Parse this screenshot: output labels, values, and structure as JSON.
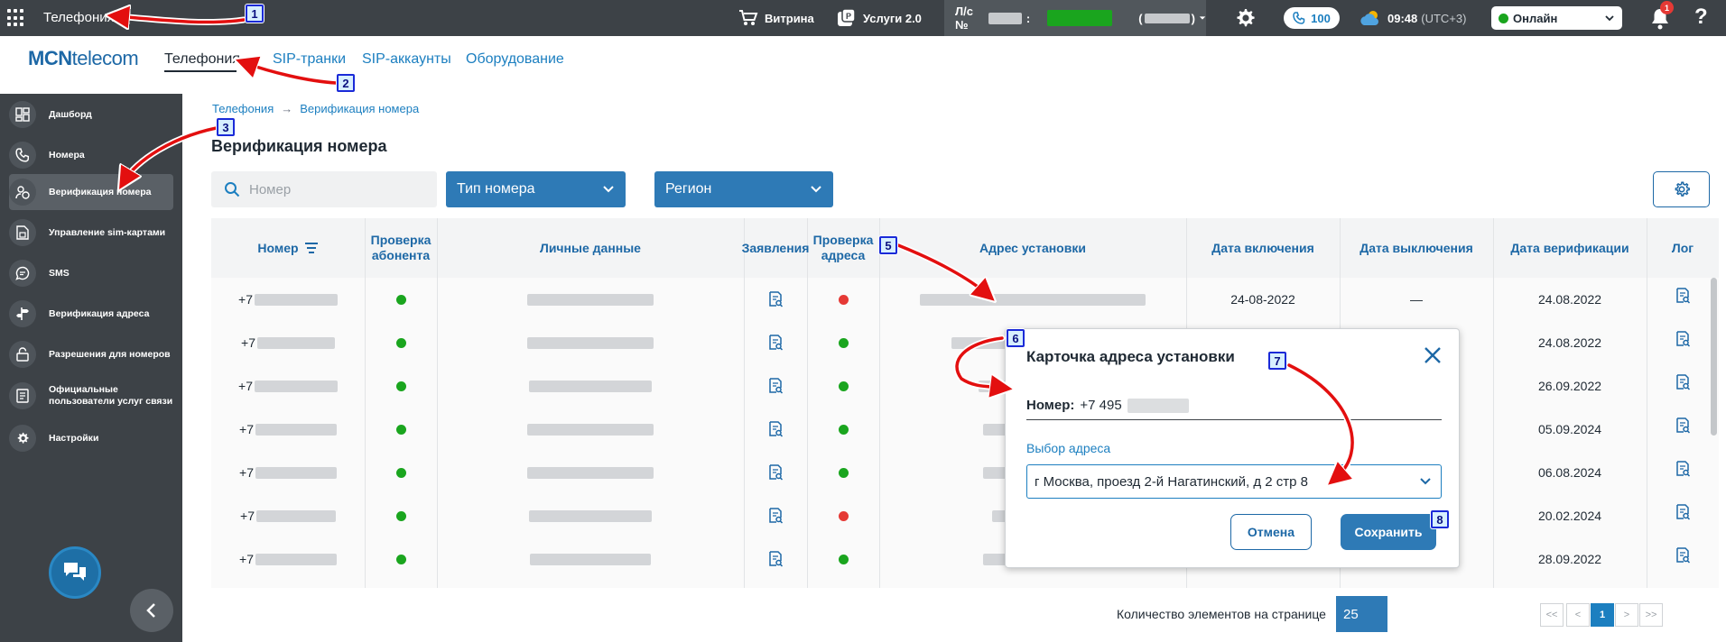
{
  "topbar": {
    "app_title": "Телефония",
    "showcase_label": "Витрина",
    "services_label": "Услуги 2.0",
    "account_prefix": "Л/с №",
    "account_sep": ":",
    "call_count": "100",
    "time": "09:48",
    "timezone": "(UTC+3)",
    "status_value": "Онлайн",
    "notification_count": "1",
    "help_label": "?"
  },
  "header": {
    "logo_bold": "MCN",
    "logo_rest": "telecom",
    "tabs": [
      {
        "label": "Телефония"
      },
      {
        "label": "SIP-транки"
      },
      {
        "label": "SIP-аккаунты"
      },
      {
        "label": "Оборудование"
      }
    ]
  },
  "sidebar": {
    "items": [
      {
        "label": "Дашборд"
      },
      {
        "label": "Номера"
      },
      {
        "label": "Верификация номера"
      },
      {
        "label": "Управление sim-картами"
      },
      {
        "label": "SMS"
      },
      {
        "label": "Верификация адреса"
      },
      {
        "label": "Разрешения для номеров"
      },
      {
        "label": "Официальные пользователи услуг связи"
      },
      {
        "label": "Настройки"
      }
    ]
  },
  "main": {
    "breadcrumb": [
      "Телефония",
      "Верификация номера"
    ],
    "title": "Верификация номера",
    "search_placeholder": "Номер",
    "filter_type": "Тип номера",
    "filter_region": "Регион"
  },
  "table": {
    "columns": [
      "Номер",
      "Проверка абонента",
      "Личные данные",
      "Заявления",
      "Проверка адреса",
      "Адрес установки",
      "Дата включения",
      "Дата выключения",
      "Дата верификации",
      "Лог"
    ],
    "rows": [
      {
        "number_prefix": "+7",
        "subscriber_check": "green",
        "address_check": "red",
        "date_on": "24-08-2022",
        "date_off": "—",
        "date_verified": "24.08.2022"
      },
      {
        "number_prefix": "+7",
        "subscriber_check": "green",
        "address_check": "green",
        "date_on": "",
        "date_off": "",
        "date_verified": "24.08.2022"
      },
      {
        "number_prefix": "+7",
        "subscriber_check": "green",
        "address_check": "green",
        "date_on": "",
        "date_off": "",
        "date_verified": "26.09.2022"
      },
      {
        "number_prefix": "+7",
        "subscriber_check": "green",
        "address_check": "green",
        "date_on": "",
        "date_off": "",
        "date_verified": "05.09.2024"
      },
      {
        "number_prefix": "+7",
        "subscriber_check": "green",
        "address_check": "green",
        "date_on": "",
        "date_off": "",
        "date_verified": "06.08.2024"
      },
      {
        "number_prefix": "+7",
        "subscriber_check": "green",
        "address_check": "red",
        "date_on": "",
        "date_off": "",
        "date_verified": "20.02.2024"
      },
      {
        "number_prefix": "+7",
        "subscriber_check": "green",
        "address_check": "green",
        "date_on": "",
        "date_off": "",
        "date_verified": "28.09.2022"
      }
    ]
  },
  "pagination": {
    "per_page_label": "Количество элементов на странице",
    "per_page_value": "25",
    "first": "<<",
    "prev": "<",
    "current": "1",
    "next": ">",
    "last": ">>"
  },
  "modal": {
    "title": "Карточка адреса установки",
    "number_label": "Номер:",
    "number_prefix": "+7 495",
    "address_label": "Выбор адреса",
    "address_value": "г Москва, проезд 2-й Нагатинский, д 2 стр 8",
    "cancel_label": "Отмена",
    "save_label": "Сохранить"
  },
  "markers": [
    "1",
    "2",
    "3",
    "5",
    "6",
    "7",
    "8"
  ],
  "colors": {
    "topbar_bg": "#3d4247",
    "sidebar_bg": "#3d4247",
    "accent_blue": "#2e7ab6",
    "link_blue": "#1c7fc0",
    "status_green": "#1aa51e",
    "status_red": "#e53935",
    "annotation_arrow": "#e30f0f"
  }
}
